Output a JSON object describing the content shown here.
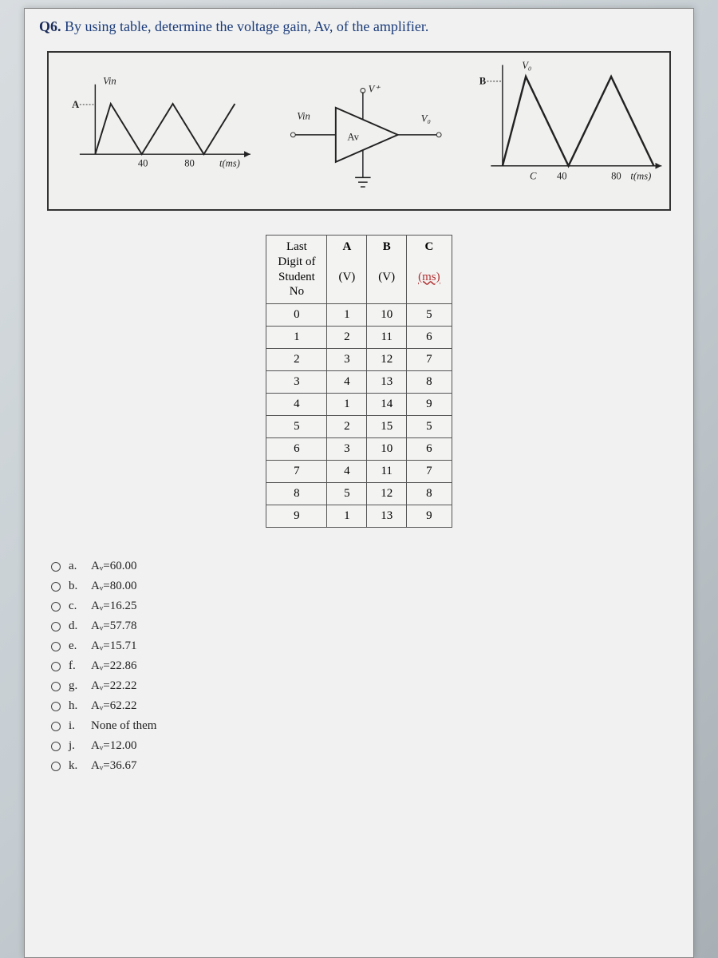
{
  "question": {
    "prefix": "Q6.",
    "text": "By using table, determine the voltage gain, Av, of the amplifier."
  },
  "diagram": {
    "left_label_top": "Vin",
    "left_label_A": "A",
    "left_x_val": "40",
    "left_x_val2": "80",
    "left_x_unit": "t(ms)",
    "amp_vin": "Vin",
    "amp_vplus": "V⁺",
    "amp_av": "Av",
    "amp_vo_left": "V₀",
    "right_label_top": "V₀",
    "right_label_B": "B",
    "right_x_C": "C",
    "right_x_val": "40",
    "right_x_val2": "80",
    "right_x_unit": "t(ms)"
  },
  "table": {
    "headers": {
      "col0_line1": "Last",
      "col0_line2": "Digit of",
      "col0_line3": "Student",
      "col0_line4": "No",
      "colA": "A",
      "colA_unit": "(V)",
      "colB": "B",
      "colB_unit": "(V)",
      "colC": "C",
      "colC_unit": "(ms)"
    },
    "rows": [
      {
        "d": "0",
        "a": "1",
        "b": "10",
        "c": "5"
      },
      {
        "d": "1",
        "a": "2",
        "b": "11",
        "c": "6"
      },
      {
        "d": "2",
        "a": "3",
        "b": "12",
        "c": "7"
      },
      {
        "d": "3",
        "a": "4",
        "b": "13",
        "c": "8"
      },
      {
        "d": "4",
        "a": "1",
        "b": "14",
        "c": "9"
      },
      {
        "d": "5",
        "a": "2",
        "b": "15",
        "c": "5"
      },
      {
        "d": "6",
        "a": "3",
        "b": "10",
        "c": "6"
      },
      {
        "d": "7",
        "a": "4",
        "b": "11",
        "c": "7"
      },
      {
        "d": "8",
        "a": "5",
        "b": "12",
        "c": "8"
      },
      {
        "d": "9",
        "a": "1",
        "b": "13",
        "c": "9"
      }
    ]
  },
  "options": [
    {
      "letter": "a.",
      "text": "Aᵥ=60.00"
    },
    {
      "letter": "b.",
      "text": "Aᵥ=80.00"
    },
    {
      "letter": "c.",
      "text": "Aᵥ=16.25"
    },
    {
      "letter": "d.",
      "text": "Aᵥ=57.78"
    },
    {
      "letter": "e.",
      "text": "Aᵥ=15.71"
    },
    {
      "letter": "f.",
      "text": "Aᵥ=22.86"
    },
    {
      "letter": "g.",
      "text": "Aᵥ=22.22"
    },
    {
      "letter": "h.",
      "text": "Aᵥ=62.22"
    },
    {
      "letter": "i.",
      "text": "None of them"
    },
    {
      "letter": "j.",
      "text": "Aᵥ=12.00"
    },
    {
      "letter": "k.",
      "text": "Aᵥ=36.67"
    }
  ]
}
